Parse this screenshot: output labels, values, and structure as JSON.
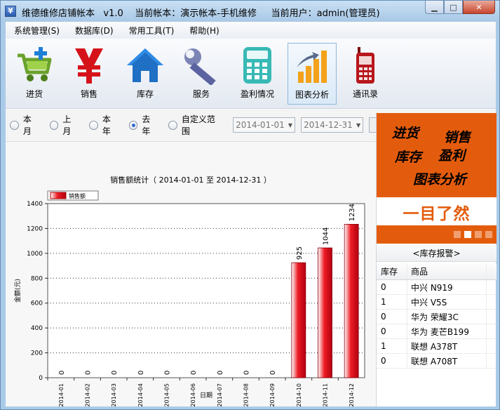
{
  "window": {
    "title": "维德维修店铺帐本   v1.0    当前帐本：演示帐本-手机维修     当前用户：admin(管理员)",
    "minimize": "▁",
    "maximize": "□",
    "close": "✕"
  },
  "menu": [
    "系统管理(S)",
    "数据库(D)",
    "常用工具(T)",
    "帮助(H)"
  ],
  "toolbar": [
    {
      "label": "进货",
      "icon": "cart-icon"
    },
    {
      "label": "销售",
      "icon": "yen-icon"
    },
    {
      "label": "库存",
      "icon": "house-icon"
    },
    {
      "label": "服务",
      "icon": "wrench-icon"
    },
    {
      "label": "盈利情况",
      "icon": "calculator-icon"
    },
    {
      "label": "图表分析",
      "icon": "bar-chart-icon",
      "active": true
    },
    {
      "label": "通讯录",
      "icon": "phone-icon"
    }
  ],
  "filter": {
    "options": [
      {
        "label": "本月",
        "selected": false
      },
      {
        "label": "上月",
        "selected": false
      },
      {
        "label": "本年",
        "selected": false
      },
      {
        "label": "去年",
        "selected": true
      },
      {
        "label": "自定义范围",
        "selected": false
      }
    ],
    "date_from": "2014-01-01",
    "date_to": "2014-12-31"
  },
  "banner": {
    "words": [
      "进货",
      "销售",
      "库存",
      "盈利",
      "图表分析"
    ],
    "slogan": "一目了然",
    "pages": 4,
    "active_page": 1
  },
  "stock": {
    "title": "<库存报警>",
    "headers": [
      "库存",
      "商品"
    ],
    "rows": [
      {
        "qty": "0",
        "name": "中兴 N919"
      },
      {
        "qty": "1",
        "name": "中兴 V5S"
      },
      {
        "qty": "0",
        "name": "华为 荣耀3C"
      },
      {
        "qty": "0",
        "name": "华为 麦芒B199"
      },
      {
        "qty": "1",
        "name": "联想 A378T"
      },
      {
        "qty": "0",
        "name": "联想 A708T"
      }
    ]
  },
  "colors": {
    "bar": "#ee1c24",
    "banner": "#e35c0d",
    "accent": "#2d6ad3"
  },
  "chart_data": {
    "type": "bar",
    "title": "销售额统计（ 2014-01-01 至 2014-12-31 ）",
    "xlabel": "日期",
    "ylabel": "金额(元)",
    "legend": "销售额",
    "legend_position": "top-left",
    "grid": true,
    "ylim": [
      0,
      1400
    ],
    "yticks": [
      0,
      200,
      400,
      600,
      800,
      1000,
      1200,
      1400
    ],
    "categories": [
      "2014-01",
      "2014-02",
      "2014-03",
      "2014-04",
      "2014-05",
      "2014-06",
      "2014-07",
      "2014-08",
      "2014-09",
      "2014-10",
      "2014-11",
      "2014-12"
    ],
    "series": [
      {
        "name": "销售额",
        "values": [
          0,
          0,
          0,
          0,
          0,
          0,
          0,
          0,
          0,
          925,
          1044,
          1234
        ]
      }
    ]
  }
}
